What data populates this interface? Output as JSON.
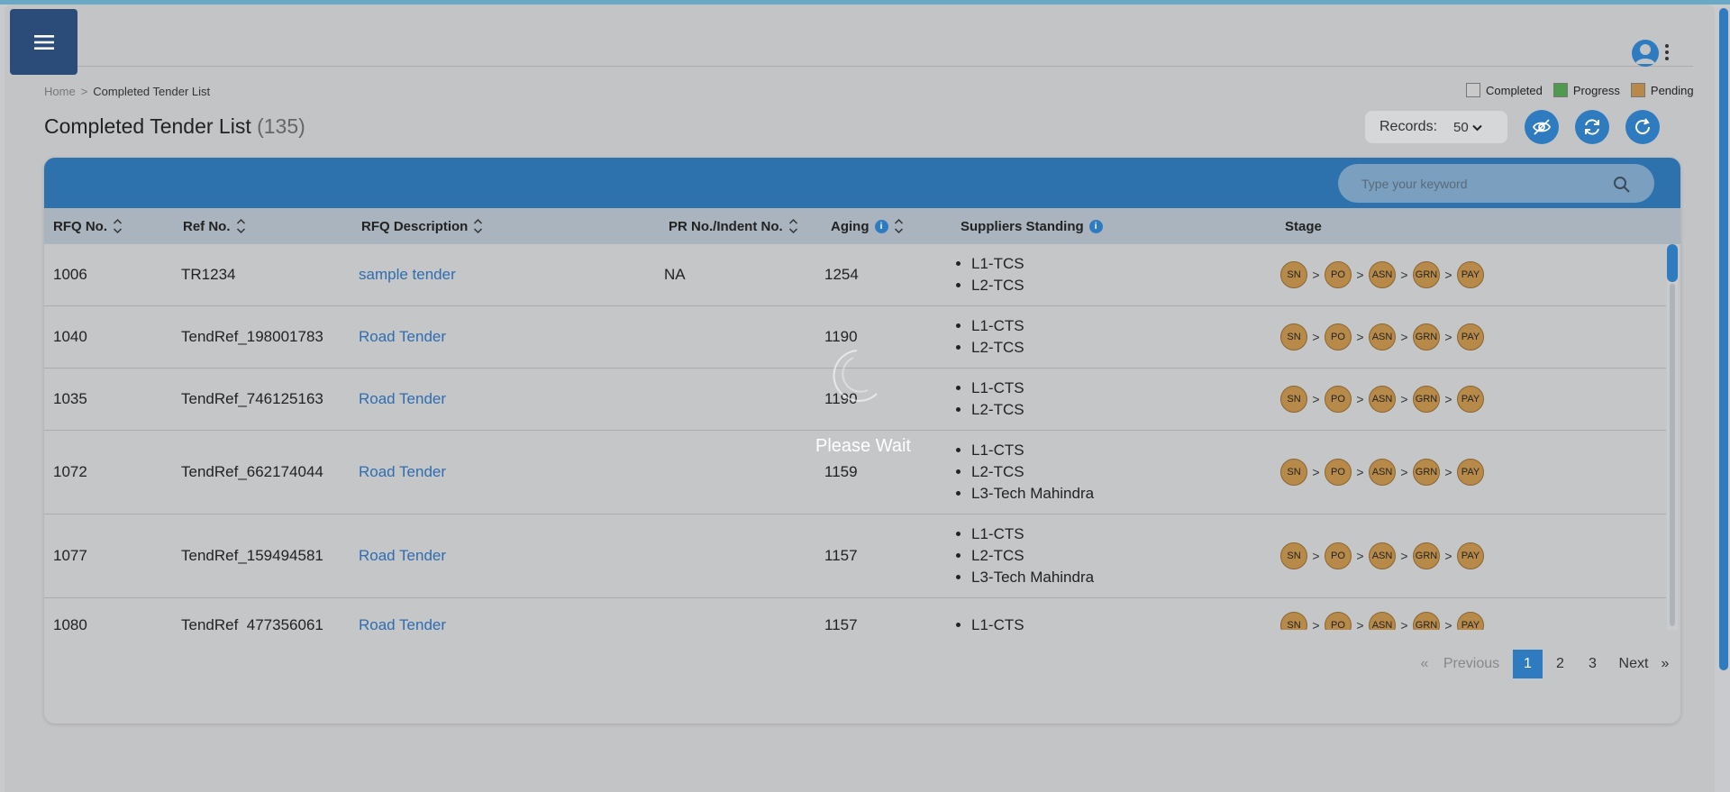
{
  "breadcrumb": {
    "home": "Home",
    "separator": ">",
    "current": "Completed Tender List"
  },
  "legend": [
    {
      "label": "Completed",
      "color": "#c9c9c9"
    },
    {
      "label": "Progress",
      "color": "#4f9a4f"
    },
    {
      "label": "Pending",
      "color": "#b78a4a"
    }
  ],
  "page": {
    "title": "Completed Tender List",
    "count": "(135)"
  },
  "records": {
    "label": "Records:",
    "value": "50"
  },
  "search": {
    "placeholder": "Type your keyword"
  },
  "columns": [
    "RFQ No.",
    "Ref No.",
    "RFQ Description",
    "PR No./Indent No.",
    "Aging",
    "Suppliers Standing",
    "Stage"
  ],
  "rows": [
    {
      "rfq": "1006",
      "ref": "TR1234",
      "desc": "sample tender",
      "pr": "NA",
      "aging": "1254",
      "suppliers": [
        "L1-TCS",
        "L2-TCS"
      ]
    },
    {
      "rfq": "1040",
      "ref": "TendRef_198001783",
      "desc": "Road Tender",
      "pr": "",
      "aging": "1190",
      "suppliers": [
        "L1-CTS",
        "L2-TCS"
      ]
    },
    {
      "rfq": "1035",
      "ref": "TendRef_746125163",
      "desc": "Road Tender",
      "pr": "",
      "aging": "1190",
      "suppliers": [
        "L1-CTS",
        "L2-TCS"
      ]
    },
    {
      "rfq": "1072",
      "ref": "TendRef_662174044",
      "desc": "Road Tender",
      "pr": "",
      "aging": "1159",
      "suppliers": [
        "L1-CTS",
        "L2-TCS",
        "L3-Tech Mahindra"
      ]
    },
    {
      "rfq": "1077",
      "ref": "TendRef_159494581",
      "desc": "Road Tender",
      "pr": "",
      "aging": "1157",
      "suppliers": [
        "L1-CTS",
        "L2-TCS",
        "L3-Tech Mahindra"
      ]
    },
    {
      "rfq": "1080",
      "ref": "TendRef_477356061",
      "desc": "Road Tender",
      "pr": "",
      "aging": "1157",
      "suppliers": [
        "L1-CTS"
      ]
    }
  ],
  "stages": [
    "SN",
    "PO",
    "ASN",
    "GRN",
    "PAY"
  ],
  "stage_status": "Pending",
  "stage_arrow": ">",
  "pagination": {
    "first": "«",
    "previous": "Previous",
    "pages": [
      "1",
      "2",
      "3"
    ],
    "current": "1",
    "next": "Next",
    "last": "»"
  },
  "loading": {
    "text": "Please Wait"
  },
  "colors": {
    "accent": "#2f7bbf",
    "header": "#2d72ad",
    "nav": "#2b4b78",
    "pending": "#b78a4a"
  }
}
